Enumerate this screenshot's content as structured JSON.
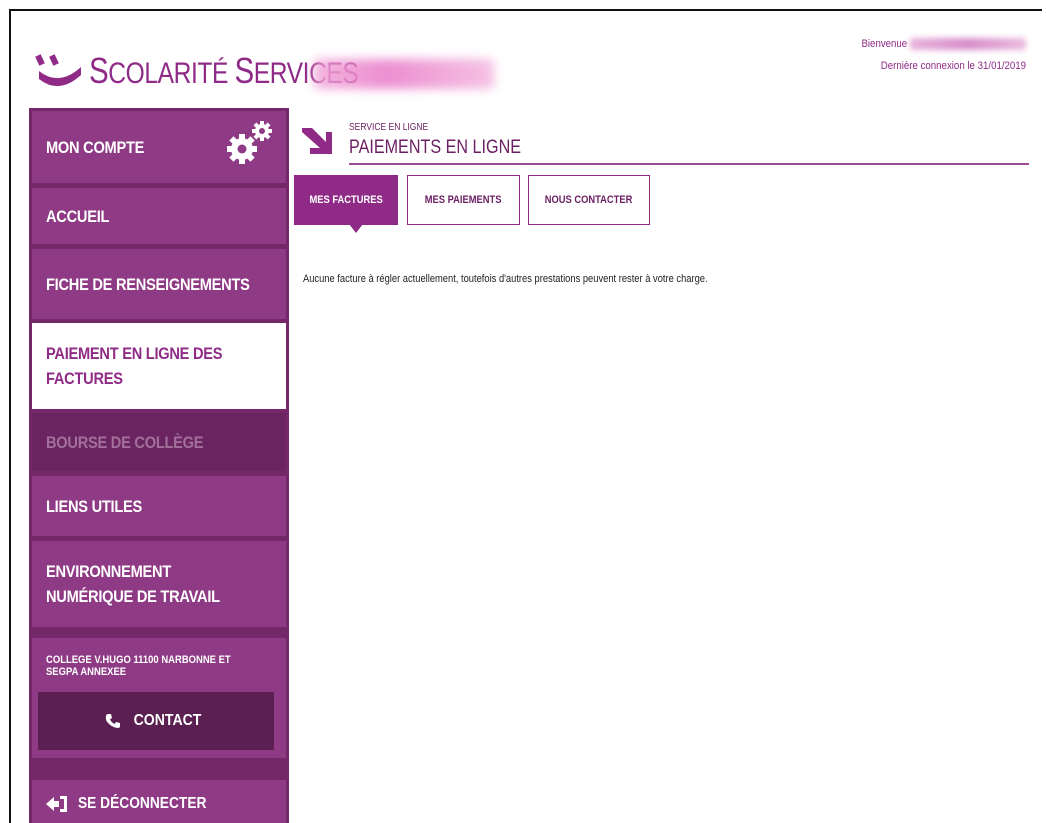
{
  "brand": {
    "name": "SCOLARITÉ SERVICES",
    "name_first_letter": "S",
    "name_rest_1": "COLARITÉ ",
    "name_second_letter": "S",
    "name_rest_2": "ERVICES",
    "color": "#8f2b87"
  },
  "header": {
    "welcome_label": "Bienvenue",
    "last_login": "Dernière connexion le 31/01/2019"
  },
  "sidebar": {
    "items": [
      {
        "label": "MON COMPTE",
        "state": "normal",
        "icon": "gear-icon"
      },
      {
        "label": "ACCUEIL",
        "state": "normal"
      },
      {
        "label": "FICHE DE RENSEIGNEMENTS",
        "state": "normal"
      },
      {
        "label_line1": "PAIEMENT EN LIGNE DES",
        "label_line2": "FACTURES",
        "state": "active"
      },
      {
        "label": "BOURSE DE COLLÈGE",
        "state": "disabled"
      },
      {
        "label": "LIENS UTILES",
        "state": "normal"
      },
      {
        "label_line1": "ENVIRONNEMENT",
        "label_line2": "NUMÉRIQUE DE TRAVAIL",
        "state": "normal"
      }
    ],
    "school": {
      "line1": "COLLEGE V.HUGO 11100 NARBONNE ET",
      "line2": "SEGPA ANNEXEE"
    },
    "contact_label": "CONTACT",
    "logout_label": "SE DÉCONNECTER"
  },
  "main": {
    "eyebrow": "SERVICE EN LIGNE",
    "title": "PAIEMENTS EN LIGNE",
    "tabs": [
      {
        "label": "MES FACTURES",
        "active": true
      },
      {
        "label": "MES PAIEMENTS",
        "active": false
      },
      {
        "label": "NOUS CONTACTER",
        "active": false
      }
    ],
    "message": "Aucune facture à régler actuellement, toutefois d'autres prestations peuvent rester à votre charge."
  },
  "colors": {
    "primary": "#8f2b87",
    "sidebar_bg": "#742869",
    "sidebar_item": "#8f3a85",
    "contact_bg": "#5b1f52"
  }
}
